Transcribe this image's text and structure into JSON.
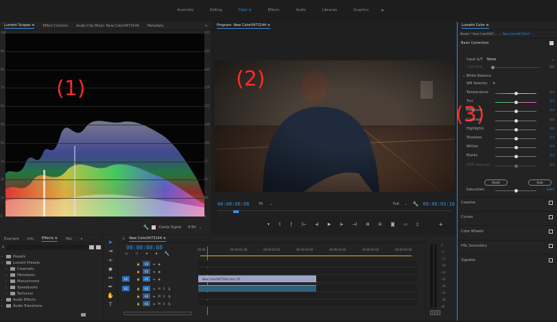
{
  "workspaces": [
    "Assembly",
    "Editing",
    "Color",
    "Effects",
    "Audio",
    "Libraries",
    "Graphics"
  ],
  "workspace_active": "Color",
  "workspace_more": "»",
  "source_tabs": [
    "Lumetri Scopes",
    "Effect Controls",
    "Audio Clip Mixer: New Color0473144",
    "Metadata"
  ],
  "source_more": "»",
  "scope_left_scale": [
    "100",
    "90",
    "80",
    "70",
    "60",
    "50",
    "40",
    "30",
    "20",
    "10",
    "0"
  ],
  "scope_right_scale": [
    "255",
    "230",
    "204",
    "179",
    "153",
    "128",
    "102",
    "77",
    "51",
    "26",
    "0"
  ],
  "scope_footer": {
    "clamp_label": "Clamp Signal",
    "bit_label": "8 Bit"
  },
  "annotations": [
    "(1)",
    "(2)",
    "(3)"
  ],
  "program": {
    "title": "Program: New Color0473144",
    "timecode_in": "00:00:00:08",
    "fit": "Fit",
    "quality": "Full",
    "timecode_out": "00:00:03:16"
  },
  "lumetri": {
    "title": "Lumetri Color",
    "master": "Master * New Color0947...",
    "clip": "New Color0473144 *...",
    "basic_correction": "Basic Correction",
    "input_lut_label": "Input LUT",
    "input_lut_value": "None",
    "hdr_white_label": "HDR White",
    "hdr_white_value": "100",
    "white_balance": "White Balance",
    "wb_selector": "WB Selector",
    "tone": "Tone",
    "controls": [
      {
        "label": "Temperature",
        "value": "0.0",
        "pos": 0.5,
        "color": "temp"
      },
      {
        "label": "Tint",
        "value": "0.0",
        "pos": 0.5,
        "color": "tint"
      },
      {
        "label": "Exposure",
        "value": "0.0",
        "pos": 0.5,
        "color": "gray"
      },
      {
        "label": "Contrast",
        "value": "0.0",
        "pos": 0.5,
        "color": "gray"
      },
      {
        "label": "Highlights",
        "value": "0.0",
        "pos": 0.5,
        "color": "gray"
      },
      {
        "label": "Shadows",
        "value": "0.0",
        "pos": 0.5,
        "color": "gray"
      },
      {
        "label": "Whites",
        "value": "0.0",
        "pos": 0.5,
        "color": "gray"
      },
      {
        "label": "Blacks",
        "value": "0.0",
        "pos": 0.5,
        "color": "gray"
      },
      {
        "label": "HDR Specular",
        "value": "0.0",
        "pos": 0.5,
        "color": "dim"
      }
    ],
    "reset_label": "Reset",
    "auto_label": "Auto",
    "saturation_label": "Saturation",
    "saturation_value": "100.0",
    "sections": [
      "Creative",
      "Curves",
      "Color Wheels",
      "HSL Secondary",
      "Vignette"
    ]
  },
  "project_tabs": [
    "Example",
    "Info",
    "Effects",
    "Mar"
  ],
  "project_more": "»",
  "effects_tree": [
    {
      "label": "Presets",
      "level": 0
    },
    {
      "label": "Lumetri Presets",
      "level": 0
    },
    {
      "label": "Cinematic",
      "level": 1
    },
    {
      "label": "Filmstocks",
      "level": 1
    },
    {
      "label": "Monochrome",
      "level": 1
    },
    {
      "label": "SpeedLooks",
      "level": 1
    },
    {
      "label": "Technical",
      "level": 1
    },
    {
      "label": "Audio Effects",
      "level": 0
    },
    {
      "label": "Audio Transitions",
      "level": 0
    }
  ],
  "timeline": {
    "sequence_name": "New Color0473144",
    "timecode": "00:00:00:08",
    "ruler": [
      "00:00",
      "00:00:01:00",
      "00:00:02:00",
      "00:00:03:00",
      "00:00:04:00",
      "00:00:05:00",
      "00:00:06:00"
    ],
    "video_tracks": [
      "V3",
      "V2",
      "V1"
    ],
    "audio_tracks": [
      "A1",
      "A2",
      "A3"
    ],
    "track_source_v": "V1",
    "track_source_a": "A1",
    "clip_label": "New Color0473144.mov [V]",
    "m_label": "M",
    "s_label": "S"
  },
  "meter": {
    "scale": [
      "0",
      "-6",
      "-12",
      "-18",
      "-24",
      "-30",
      "-36",
      "-42",
      "-48",
      "dB"
    ],
    "solo": [
      "S",
      "S"
    ]
  },
  "colors": {
    "accent": "#3a8de6",
    "annotation": "#ff2a2a",
    "clip": "#9ea3c8",
    "audio_clip": "#2f5f7a"
  }
}
